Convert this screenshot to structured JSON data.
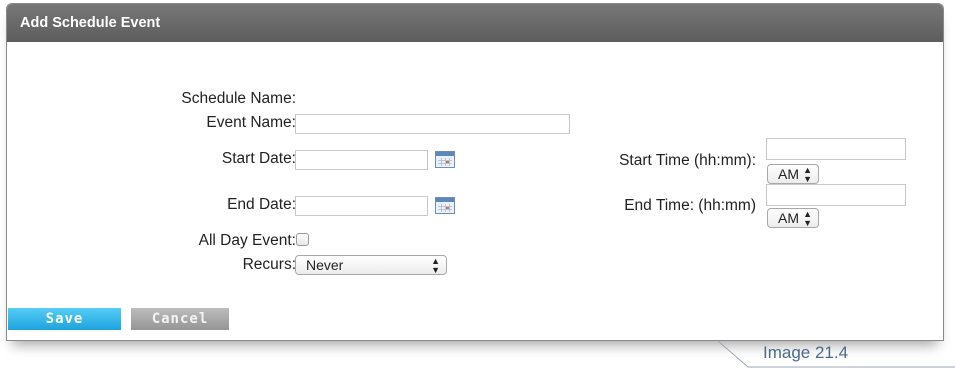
{
  "dialog": {
    "title": "Add Schedule Event"
  },
  "form": {
    "schedule_name_label": "Schedule Name:",
    "schedule_name_value": "",
    "event_name_label": "Event Name:",
    "event_name_value": "",
    "start_date_label": "Start Date:",
    "start_date_value": "",
    "end_date_label": "End Date:",
    "end_date_value": "",
    "all_day_label": "All Day Event:",
    "all_day_checked": false,
    "recurs_label": "Recurs:",
    "recurs_value": "Never",
    "start_time_label": "Start Time (hh:mm):",
    "start_time_value": "",
    "start_ampm": "AM",
    "end_time_label": "End Time: (hh:mm)",
    "end_time_value": "",
    "end_ampm": "AM"
  },
  "buttons": {
    "save": "Save",
    "cancel": "Cancel"
  },
  "icons": {
    "calendar": "calendar-icon",
    "updown": "up-down-arrows-icon"
  },
  "colors": {
    "titlebar": "#666666",
    "save_button": "#29b4e8",
    "cancel_button": "#a8a8a8",
    "caption": "#4a6a8a"
  },
  "caption": "Image 21.4"
}
